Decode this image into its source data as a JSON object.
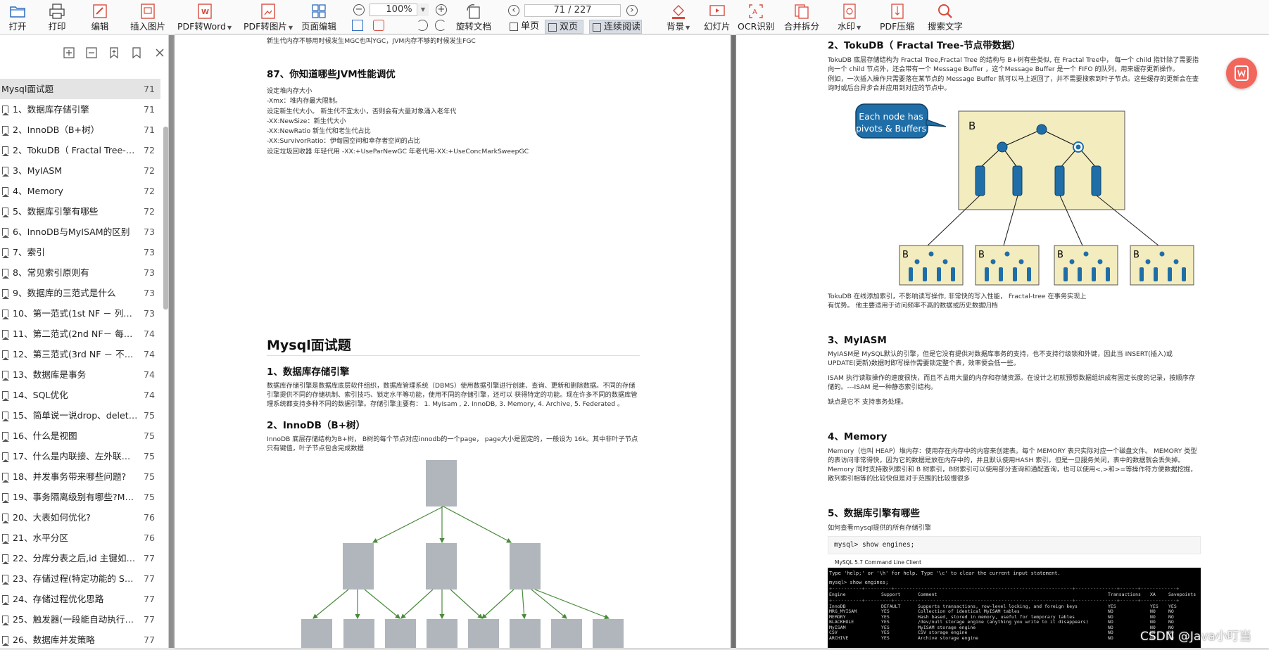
{
  "toolbar": {
    "open": "打开",
    "print": "打印",
    "edit": "编辑",
    "insert_image": "插入图片",
    "pdf_to_word": "PDF转Word",
    "pdf_to_image": "PDF转图片",
    "page_edit": "页面编辑",
    "zoom": "100%",
    "rotate": "旋转文档",
    "page_indicator": "71 / 227",
    "single_page": "单页",
    "double_page": "双页",
    "continuous": "连续阅读",
    "background": "背景",
    "slideshow": "幻灯片",
    "ocr": "OCR识别",
    "merge_split": "合并拆分",
    "watermark": "水印",
    "compress": "PDF压缩",
    "search": "搜索文字",
    "accent_color": "#d84b3e"
  },
  "outline": {
    "title": "Mysql面试题",
    "title_page": "71",
    "items": [
      {
        "label": "1、数据库存储引擎",
        "page": "71"
      },
      {
        "label": "2、InnoDB（B+树）",
        "page": "71"
      },
      {
        "label": "2、TokuDB（ Fractal Tree-节...",
        "page": "72"
      },
      {
        "label": "3、MyIASM",
        "page": "72"
      },
      {
        "label": "4、Memory",
        "page": "72"
      },
      {
        "label": "5、数据库引擎有哪些",
        "page": "72"
      },
      {
        "label": "6、InnoDB与MyISAM的区别",
        "page": "73"
      },
      {
        "label": "7、索引",
        "page": "73"
      },
      {
        "label": "8、常见索引原则有",
        "page": "73"
      },
      {
        "label": "9、数据库的三范式是什么",
        "page": "73"
      },
      {
        "label": "10、第一范式(1st NF － 列都...",
        "page": "73"
      },
      {
        "label": "11、第二范式(2nd NF－ 每个...",
        "page": "74"
      },
      {
        "label": "12、第三范式(3rd NF － 不存...",
        "page": "74"
      },
      {
        "label": "13、数据库是事务",
        "page": "74"
      },
      {
        "label": "14、SQL优化",
        "page": "74"
      },
      {
        "label": "15、简单说一说drop、delete...",
        "page": "75"
      },
      {
        "label": "16、什么是视图",
        "page": "75"
      },
      {
        "label": "17、什么是内联接、左外联接...",
        "page": "75"
      },
      {
        "label": "18、并发事务带来哪些问题?",
        "page": "75"
      },
      {
        "label": "19、事务隔离级别有哪些?MyS...",
        "page": "75"
      },
      {
        "label": "20、大表如何优化?",
        "page": "76"
      },
      {
        "label": "21、水平分区",
        "page": "76"
      },
      {
        "label": "22、分库分表之后,id 主键如何...",
        "page": "77"
      },
      {
        "label": "23、存储过程(特定功能的 SQL...",
        "page": "77"
      },
      {
        "label": "24、存储过程优化思路",
        "page": "77"
      },
      {
        "label": "25、触发器(一段能自动执行的...",
        "page": "77"
      },
      {
        "label": "26、数据库并发策略",
        "page": "77"
      }
    ]
  },
  "left_page": {
    "top_line": "新生代内存不够用时候发生MGC也叫YGC，JVM内存不够的时候发生FGC",
    "q87_title": "87、你知道哪些JVM性能调优",
    "q87_lines": [
      "设定堆内存大小",
      "-Xmx：堆内存最大限制。",
      "设定新生代大小。 新生代不宜太小，否则会有大量对象涌入老年代",
      "-XX:NewSize：新生代大小",
      "-XX:NewRatio 新生代和老生代占比",
      "-XX:SurvivorRatio：伊甸园空间和幸存者空间的占比",
      "设定垃圾回收器 年轻代用 -XX:+UseParNewGC 年老代用-XX:+UseConcMarkSweepGC"
    ],
    "section_title": "Mysql面试题",
    "s1_title": "1、数据库存储引擎",
    "s1_text": "数据库存储引擎是数据库底层软件组织，数据库管理系统（DBMS）使用数据引擎进行创建、查询、更新和删除数据。不同的存储引擎提供不同的存储机制、索引技巧、锁定水平等功能，使用不同的存储引擎，还可以 获得特定的功能。现在许多不同的数据库管理系统都支持多种不同的数据引擎。存储引擎主要有： 1. MyIsam , 2. InnoDB, 3. Memory, 4. Archive, 5. Federated 。",
    "s2_title": "2、InnoDB（B+树）",
    "s2_text": "InnoDB 底层存储结构为B+树， B树的每个节点对应innodb的一个page， page大小是固定的，一般设为 16k。其中非叶子节点只有键值，叶子节点包含完成数据"
  },
  "right_page": {
    "toku_title": "2、TokuDB（ Fractal Tree-节点带数据）",
    "toku_text": "TokuDB 底层存储结构为 Fractal Tree,Fractal Tree 的结构与 B+树有些类似, 在 Fractal Tree中， 每一个 child 指针除了需要指向一个 child 节点外，还会带有一个 Message Buffer ，这个Message Buffer 是一个 FIFO 的队列，用来缓存更新操作。",
    "toku_text2": "例如，一次插入操作只需要落在某节点的 Message Buffer 就可以马上返回了，并不需要搜索到叶子节点。这些缓存的更新会在查询时或后台异步合并应用到对应的节点中。",
    "callout_line1": "Each node has",
    "callout_line2": "pivots & Buffers",
    "node_letter": "B",
    "toku_after": "TokuDB 在线添加索引，不影响读写操作, 非常快的写入性能， Fractal-tree 在事务实现上有优势。 他主要适用于访问频率不高的数据或历史数据归档",
    "myisam_title": "3、MyIASM",
    "myisam_text": "MyIASM是 MySQL默认的引擎，但是它没有提供对数据库事务的支持，也不支持行级锁和外键，因此当 INSERT(插入)或 UPDATE(更新)数据时即写操作需要锁定整个表，效率便会低一些。",
    "myisam_text2": "ISAM 执行读取操作的速度很快，而且不占用大量的内存和存储资源。在设计之初就预想数据组织成有固定长度的记录，按顺序存储的。---ISAM 是一种静态索引结构。",
    "myisam_text3": "缺点是它不 支持事务处理。",
    "memory_title": "4、Memory",
    "memory_text": "Memory（也叫 HEAP）堆内存：使用存在内存中的内容来创建表。每个 MEMORY 表只实际对应一个磁盘文件。 MEMORY 类型的表访问非常得快，因为它的数据是放在内存中的，并且默认使用HASH 索引。但是一旦服务关闭，表中的数据就会丢失掉。 Memory 同时支持散列索引和 B 树索引，B树索引可以使用部分查询和通配查询，也可以使用<,>和>=等操作符方便数据挖掘，散列索引相等的比较快但是对于范围的比较慢很多",
    "engines_title": "5、数据库引擎有哪些",
    "engines_text": "如何查看mysql提供的所有存储引擎",
    "code": "mysql> show engines;",
    "console_title": "MySQL 5.7 Command Line Client",
    "console_help": "Type 'help;' or '\\h' for help. Type '\\c' to clear the current input statement.",
    "console_cmd": "mysql> show engines;",
    "console_headers": [
      "Engine",
      "Support",
      "Comment",
      "Transactions",
      "XA",
      "Savepoints"
    ],
    "console_rows": [
      [
        "InnoDB",
        "DEFAULT",
        "Supports transactions, row-level locking, and foreign keys",
        "YES",
        "YES",
        "YES"
      ],
      [
        "MRG_MYISAM",
        "YES",
        "Collection of identical MyISAM tables",
        "NO",
        "NO",
        "NO"
      ],
      [
        "MEMORY",
        "YES",
        "Hash based, stored in memory, useful for temporary tables",
        "NO",
        "NO",
        "NO"
      ],
      [
        "BLACKHOLE",
        "YES",
        "/dev/null storage engine (anything you write to it disappears)",
        "NO",
        "NO",
        "NO"
      ],
      [
        "MyISAM",
        "YES",
        "MyISAM storage engine",
        "NO",
        "NO",
        "NO"
      ],
      [
        "CSV",
        "YES",
        "CSV storage engine",
        "NO",
        "NO",
        "NO"
      ],
      [
        "ARCHIVE",
        "YES",
        "Archive storage engine",
        "NO",
        "NO",
        "NO"
      ]
    ]
  },
  "watermark": "CSDN @Java小叮当"
}
